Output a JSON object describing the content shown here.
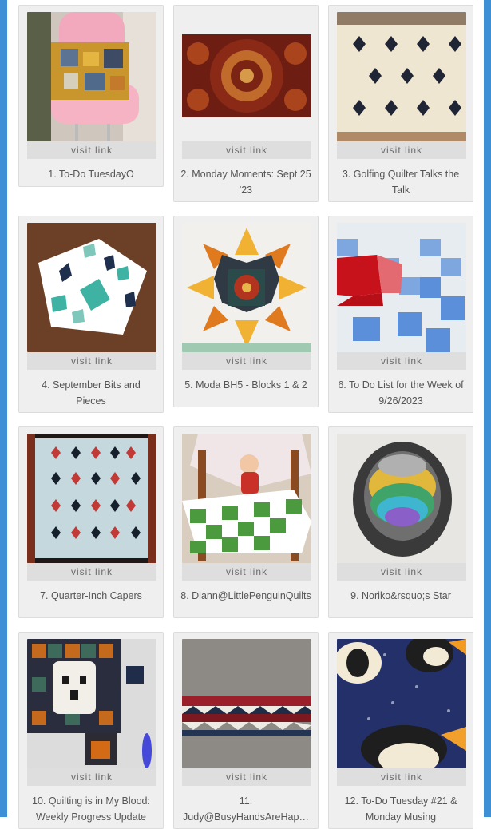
{
  "visit_label": "visit link",
  "items": [
    {
      "title": "1. To-Do TuesdayO"
    },
    {
      "title": "2. Monday Moments: Sept 25 '23"
    },
    {
      "title": "3. Golfing Quilter Talks the Talk"
    },
    {
      "title": "4. September Bits and Pieces"
    },
    {
      "title": "5. Moda BH5 - Blocks 1 & 2"
    },
    {
      "title": "6. To Do List for the Week of 9/26/2023"
    },
    {
      "title": "7. Quarter-Inch Capers"
    },
    {
      "title": "8. Diann@LittlePenguinQuilts"
    },
    {
      "title": "9. Noriko&rsquo;s Star"
    },
    {
      "title": "10. Quilting is in My Blood: Weekly Progress Update"
    },
    {
      "title": "11. Judy@BusyHandsAreHap…"
    },
    {
      "title": "12. To-Do Tuesday #21 & Monday Musing"
    }
  ],
  "colors": {
    "accent_edge": "#3d8fd6",
    "card_bg": "#efefef",
    "button_bg": "#dedede"
  }
}
